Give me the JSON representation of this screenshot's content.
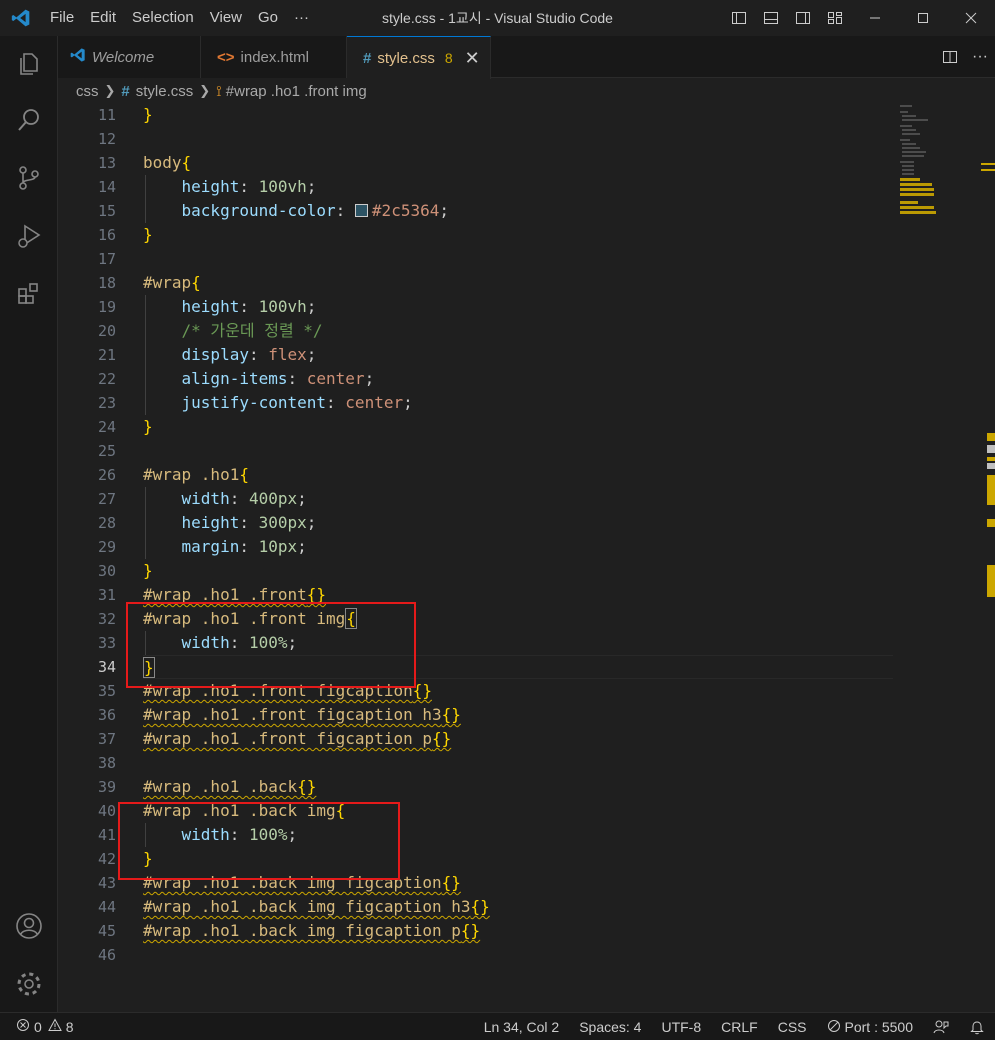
{
  "window": {
    "title": "style.css - 1교시 - Visual Studio Code",
    "menu": [
      "File",
      "Edit",
      "Selection",
      "View",
      "Go",
      "···"
    ]
  },
  "activity_bar": {
    "top_icons": [
      "explorer-icon",
      "search-icon",
      "source-control-icon",
      "run-debug-icon",
      "extensions-icon"
    ],
    "bottom_icons": [
      "account-icon",
      "settings-gear-icon"
    ]
  },
  "tabs": [
    {
      "label": "Welcome",
      "icon": "vscode-logo-icon",
      "active": false,
      "italic": true
    },
    {
      "label": "index.html",
      "icon": "html-icon",
      "active": false
    },
    {
      "label": "style.css",
      "icon": "css-hash-icon",
      "active": true,
      "problems": "8",
      "close": "✕"
    }
  ],
  "breadcrumbs": {
    "folder": "css",
    "file": "style.css",
    "symbol": "#wrap .ho1 .front img"
  },
  "editor": {
    "current_line": 34,
    "line_numbers": [
      "11",
      "12",
      "13",
      "14",
      "15",
      "16",
      "17",
      "18",
      "19",
      "20",
      "21",
      "22",
      "23",
      "24",
      "25",
      "26",
      "27",
      "28",
      "29",
      "30",
      "31",
      "32",
      "33",
      "34",
      "35",
      "36",
      "37",
      "38",
      "39",
      "40",
      "41",
      "42",
      "43",
      "44",
      "45",
      "46"
    ],
    "code": {
      "l11": "}",
      "l13_sel": "body",
      "l14_prop": "height",
      "l14_num": "100vh",
      "l15_prop": "background-color",
      "l15_val": "#2c5364",
      "l15_color": "#2c5364",
      "l18_sel": "#wrap",
      "l19_prop": "height",
      "l19_num": "100vh",
      "l20_cmt": "/* 가운데 정렬 */",
      "l21_prop": "display",
      "l21_val": "flex",
      "l22_prop": "align-items",
      "l22_val": "center",
      "l23_prop": "justify-content",
      "l23_val": "center",
      "l26_sel": "#wrap .ho1",
      "l27_prop": "width",
      "l27_num": "400px",
      "l28_prop": "height",
      "l28_num": "300px",
      "l29_prop": "margin",
      "l29_num": "10px",
      "l31_sel": "#wrap .ho1 .front",
      "l31_rest": "{}",
      "l32_sel": "#wrap .ho1 .front img",
      "l33_prop": "width",
      "l33_num": "100%",
      "l35_sel": "#wrap .ho1 .front figcaption",
      "l35_rest": "{}",
      "l36_sel": "#wrap .ho1 .front figcaption h3",
      "l36_rest": "{}",
      "l37_sel": "#wrap .ho1 .front figcaption p",
      "l37_rest": "{}",
      "l39_sel": "#wrap .ho1 .back",
      "l39_rest": "{}",
      "l40_sel": "#wrap .ho1 .back img",
      "l41_prop": "width",
      "l41_num": "100%",
      "l43_sel": "#wrap .ho1 .back img figcaption",
      "l43_rest": "{}",
      "l44_sel": "#wrap .ho1 .back img figcaption h3",
      "l44_rest": "{}",
      "l45_sel": "#wrap .ho1 .back img figcaption p",
      "l45_rest": "{}"
    }
  },
  "statusbar": {
    "errors": "0",
    "warnings": "8",
    "position": "Ln 34, Col 2",
    "spaces": "Spaces: 4",
    "encoding": "UTF-8",
    "eol": "CRLF",
    "language": "CSS",
    "port": "Port : 5500"
  },
  "colors": {
    "accent": "#0078d4",
    "warning": "#cca700",
    "annotation_box": "#e51a1a"
  }
}
